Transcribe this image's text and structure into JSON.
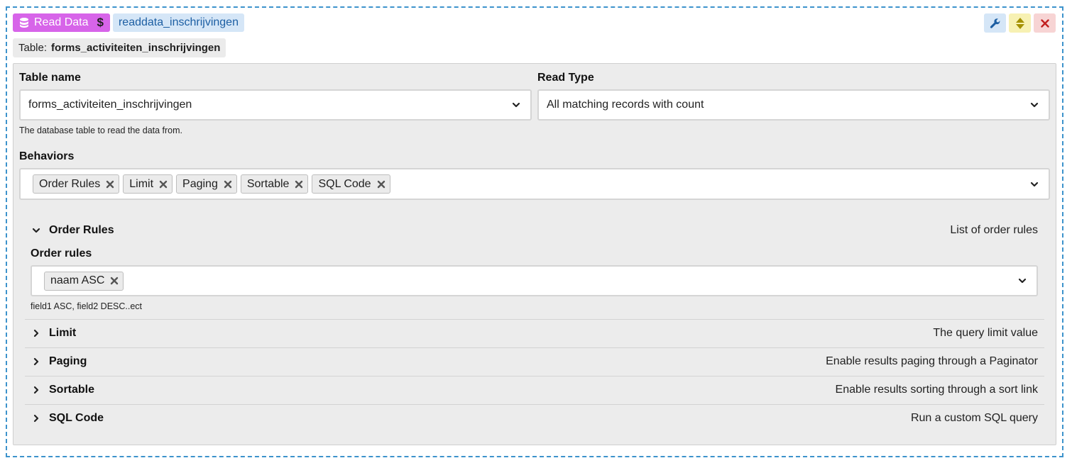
{
  "header": {
    "badge_label": "Read Data",
    "badge_icon": "database-icon",
    "dollar": "$",
    "name_badge": "readdata_inschrijvingen",
    "table_prefix": "Table:",
    "table_value": "forms_activiteiten_inschrijvingen",
    "actions": [
      "wrench-icon",
      "sort-arrows-icon",
      "close-icon"
    ]
  },
  "colors": {
    "border_dashed": "#3d93cc",
    "badge_purple": "#d764e9",
    "badge_blue_bg": "#d5e6f7",
    "badge_blue_text": "#1d5fa3",
    "yellow_bg": "#f7f1b3",
    "red_bg": "#f7d4d4",
    "panel_bg": "#ececec"
  },
  "form": {
    "table_name": {
      "label": "Table name",
      "value": "forms_activiteiten_inschrijvingen",
      "help": "The database table to read the data from."
    },
    "read_type": {
      "label": "Read Type",
      "value": "All matching records with count"
    },
    "behaviors": {
      "label": "Behaviors",
      "chips": [
        "Order Rules",
        "Limit",
        "Paging",
        "Sortable",
        "SQL Code"
      ]
    }
  },
  "sections": {
    "order_rules": {
      "title": "Order Rules",
      "desc": "List of order rules",
      "expanded": true,
      "field_label": "Order rules",
      "chips": [
        "naam ASC"
      ],
      "help": "field1 ASC, field2 DESC..ect"
    },
    "collapsed": [
      {
        "title": "Limit",
        "desc": "The query limit value"
      },
      {
        "title": "Paging",
        "desc": "Enable results paging through a Paginator"
      },
      {
        "title": "Sortable",
        "desc": "Enable results sorting through a sort link"
      },
      {
        "title": "SQL Code",
        "desc": "Run a custom SQL query"
      }
    ]
  }
}
